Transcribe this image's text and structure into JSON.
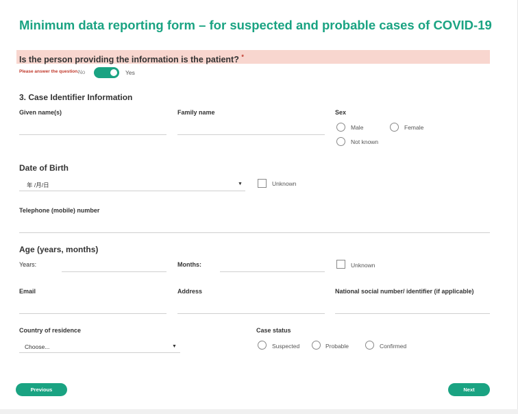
{
  "form": {
    "title": "Minimum data reporting form – for suspected and probable cases of COVID-19"
  },
  "question": {
    "text": "Is the person providing the information is the patient?",
    "required_mark": "*",
    "error": "Please answer the question.",
    "toggle_off_label": "No",
    "toggle_on_label": "Yes",
    "toggle_value": true
  },
  "case_identifier": {
    "heading": "3. Case Identifier Information",
    "given_name_label": "Given name(s)",
    "family_name_label": "Family name",
    "sex_label": "Sex",
    "sex_options": [
      "Male",
      "Female",
      "Not known"
    ]
  },
  "dob": {
    "heading": "Date of Birth",
    "value": "年 /月/日",
    "unknown_label": "Unknown"
  },
  "phone": {
    "label": "Telephone (mobile) number"
  },
  "age": {
    "heading": "Age (years, months)",
    "years_label": "Years:",
    "months_label": "Months:",
    "unknown_label": "Unknown"
  },
  "contact": {
    "email_label": "Email",
    "address_label": "Address",
    "national_id_label": "National social number/ identifier (if applicable)"
  },
  "residence": {
    "label": "Country of residence",
    "selected": "Choose..."
  },
  "case_status": {
    "label": "Case status",
    "options": [
      "Suspected",
      "Probable",
      "Confirmed"
    ]
  },
  "nav": {
    "previous": "Previous",
    "next": "Next"
  },
  "colors": {
    "accent": "#1aa382",
    "error": "#c0392b",
    "banner": "#f8d6cf"
  }
}
